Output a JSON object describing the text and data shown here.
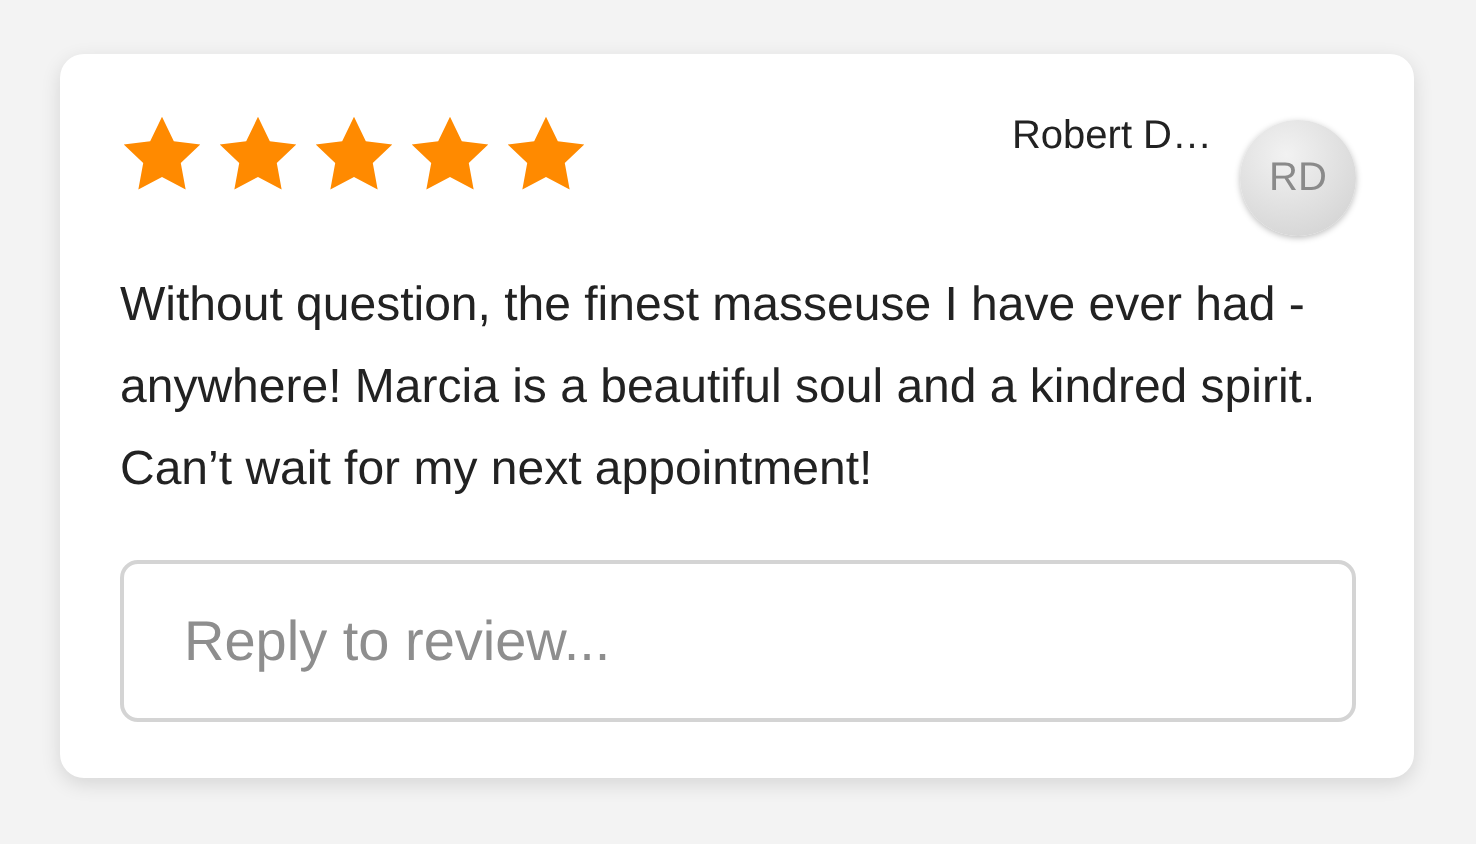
{
  "review": {
    "stars": 5,
    "author": "Robert D…",
    "avatar_initials": "RD",
    "text": "Without question, the finest masseuse I have ever had - anywhere! Marcia is a beautiful soul and a kindred spirit. Can’t wait for my next appointment!"
  },
  "reply": {
    "placeholder": "Reply to review..."
  }
}
